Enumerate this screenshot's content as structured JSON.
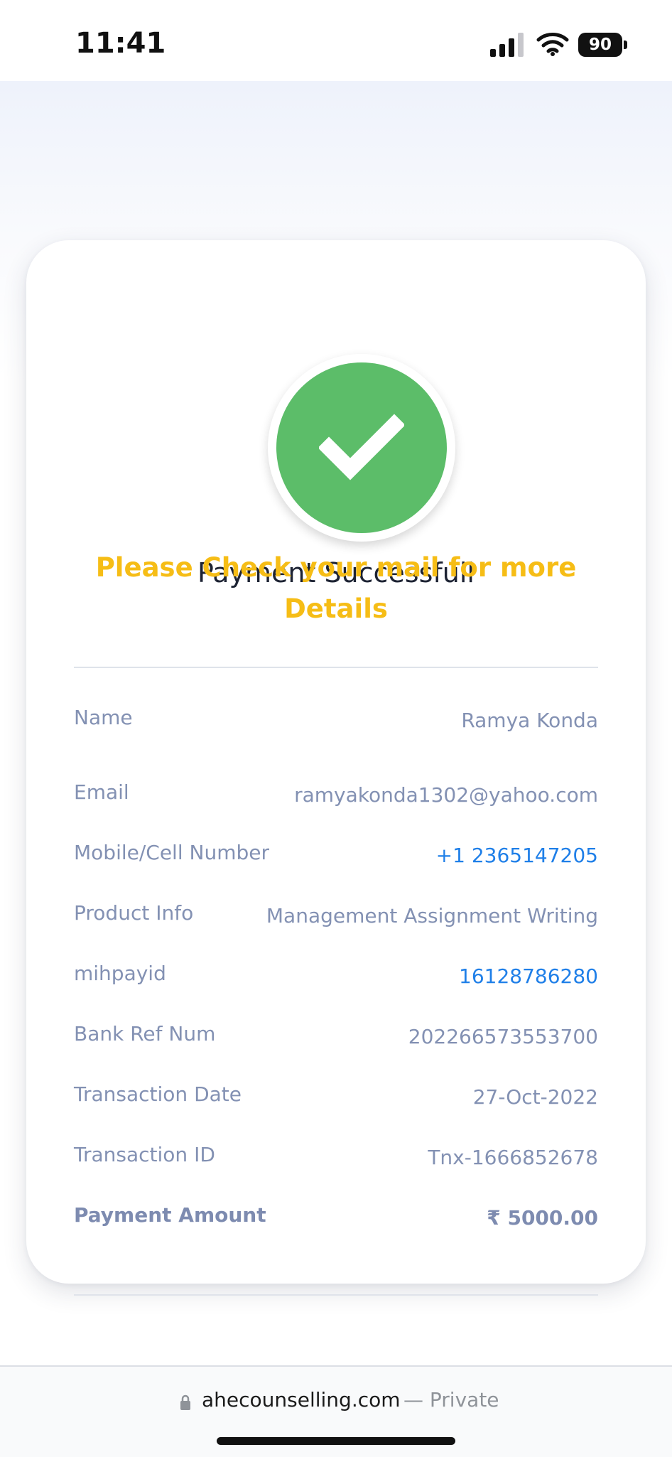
{
  "status_bar": {
    "time": "11:41",
    "battery": "90",
    "icons": [
      "signal-icon",
      "wifi-icon",
      "battery-icon"
    ]
  },
  "payment": {
    "title": "Payment Successfull",
    "subtitle": "Please Check your mail for more Details",
    "success_icon": "check-icon",
    "colors": {
      "success": "#5cbd69",
      "subtitle": "#f6bd16",
      "link": "#1f7fe8",
      "label": "#8391b3"
    }
  },
  "details": [
    {
      "label": "Name",
      "value": "Ramya Konda"
    },
    {
      "label": "Email",
      "value": "ramyakonda1302@yahoo.com"
    },
    {
      "label": "Mobile/Cell Number",
      "value": "+1 2365147205"
    },
    {
      "label": "Product Info",
      "value": "Management Assignment Writing"
    },
    {
      "label": "mihpayid",
      "value": "16128786280"
    },
    {
      "label": "Bank Ref Num",
      "value": "202266573553700"
    },
    {
      "label": "Transaction Date",
      "value": "27-Oct-2022"
    },
    {
      "label": "Transaction ID",
      "value": "Tnx-1666852678"
    },
    {
      "label": "Payment Amount",
      "value": "₹ 5000.00"
    }
  ],
  "browser": {
    "domain": "ahecounselling.com",
    "privacy": "— Private",
    "lock_icon": "lock-icon"
  }
}
